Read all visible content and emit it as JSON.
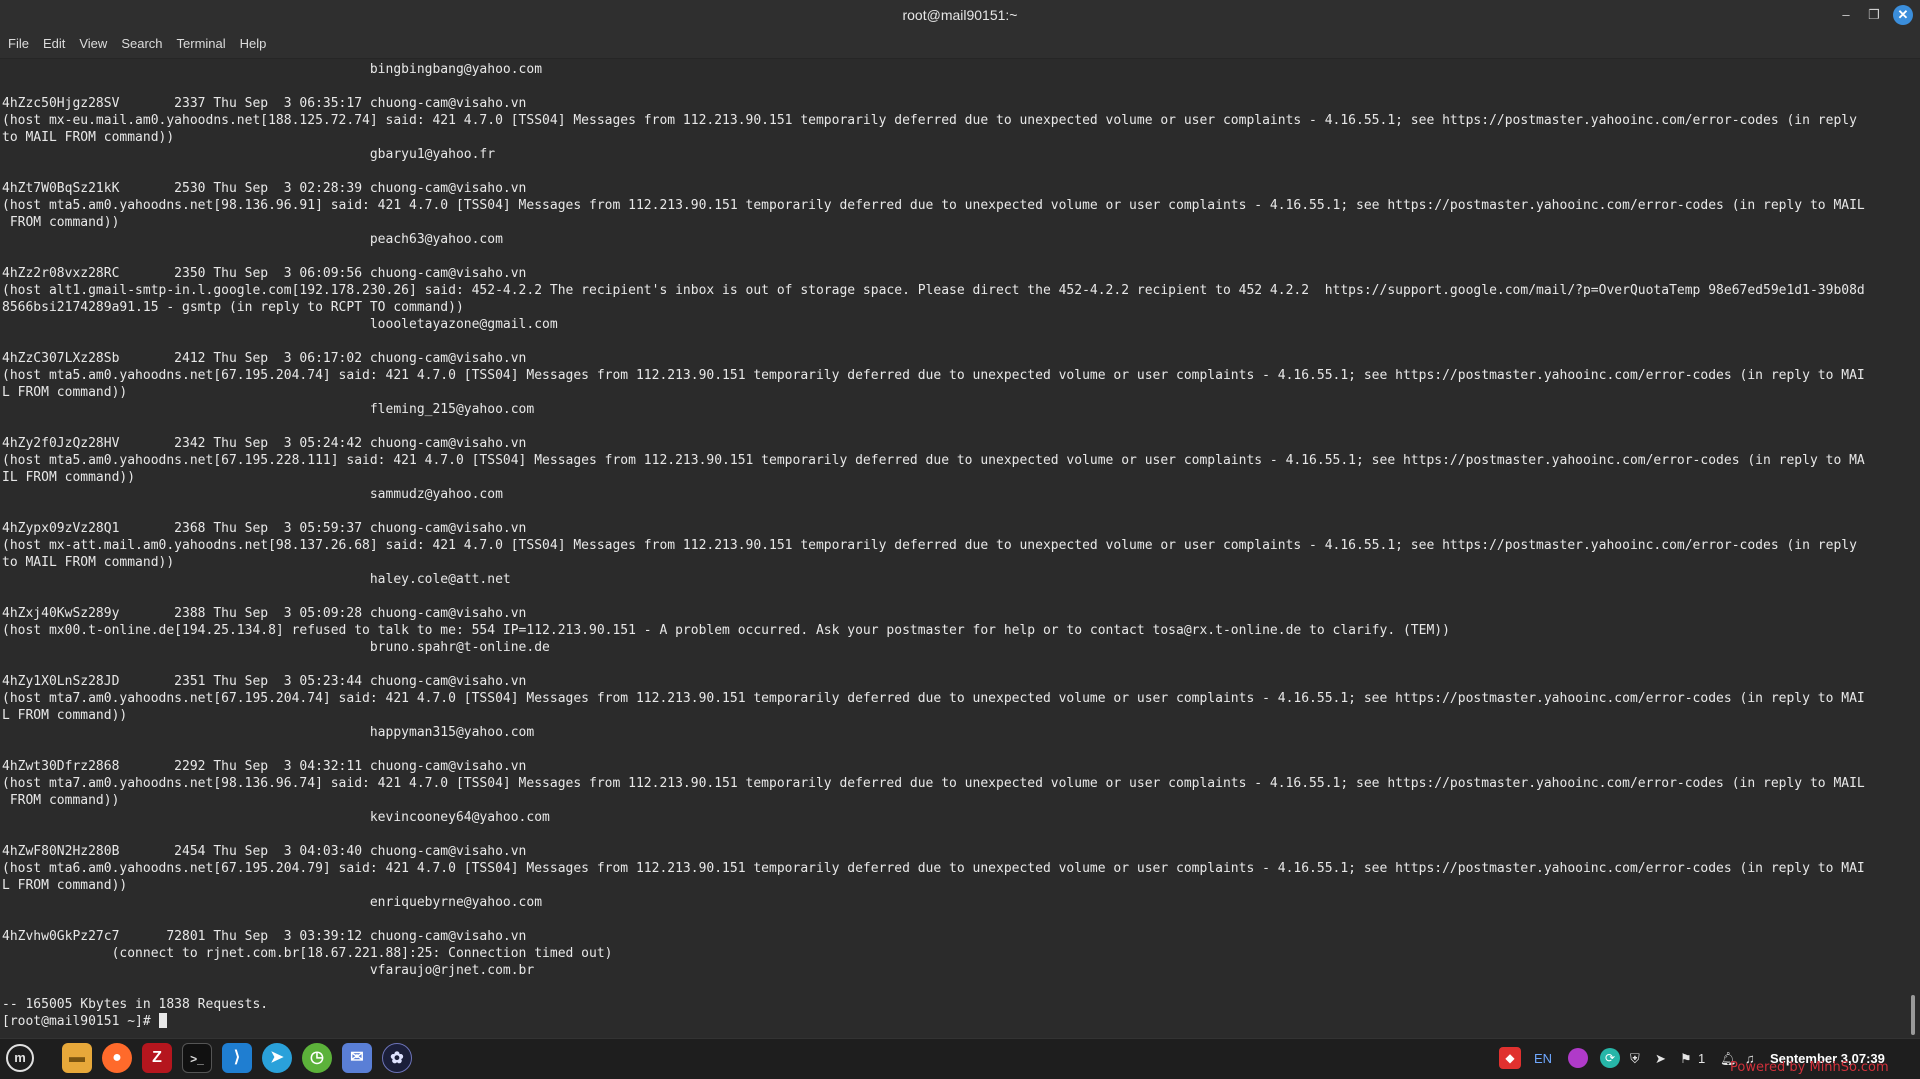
{
  "window": {
    "title": "root@mail90151:~",
    "min_glyph": "–",
    "max_glyph": "❐",
    "close_glyph": "✕"
  },
  "menu": [
    "File",
    "Edit",
    "View",
    "Search",
    "Terminal",
    "Help"
  ],
  "terminal": {
    "lines": [
      "                                               bingbingbang@yahoo.com",
      "",
      "4hZzc50Hjgz28SV       2337 Thu Sep  3 06:35:17 chuong-cam@visaho.vn",
      "(host mx-eu.mail.am0.yahoodns.net[188.125.72.74] said: 421 4.7.0 [TSS04] Messages from 112.213.90.151 temporarily deferred due to unexpected volume or user complaints - 4.16.55.1; see https://postmaster.yahooinc.com/error-codes (in reply",
      "to MAIL FROM command))",
      "                                               gbaryu1@yahoo.fr",
      "",
      "4hZt7W0BqSz21kK       2530 Thu Sep  3 02:28:39 chuong-cam@visaho.vn",
      "(host mta5.am0.yahoodns.net[98.136.96.91] said: 421 4.7.0 [TSS04] Messages from 112.213.90.151 temporarily deferred due to unexpected volume or user complaints - 4.16.55.1; see https://postmaster.yahooinc.com/error-codes (in reply to MAIL",
      " FROM command))",
      "                                               peach63@yahoo.com",
      "",
      "4hZz2r08vxz28RC       2350 Thu Sep  3 06:09:56 chuong-cam@visaho.vn",
      "(host alt1.gmail-smtp-in.l.google.com[192.178.230.26] said: 452-4.2.2 The recipient's inbox is out of storage space. Please direct the 452-4.2.2 recipient to 452 4.2.2  https://support.google.com/mail/?p=OverQuotaTemp 98e67ed59e1d1-39b08d",
      "8566bsi2174289a91.15 - gsmtp (in reply to RCPT TO command))",
      "                                               loooletayazone@gmail.com",
      "",
      "4hZzC307LXz28Sb       2412 Thu Sep  3 06:17:02 chuong-cam@visaho.vn",
      "(host mta5.am0.yahoodns.net[67.195.204.74] said: 421 4.7.0 [TSS04] Messages from 112.213.90.151 temporarily deferred due to unexpected volume or user complaints - 4.16.55.1; see https://postmaster.yahooinc.com/error-codes (in reply to MAI",
      "L FROM command))",
      "                                               fleming_215@yahoo.com",
      "",
      "4hZy2f0JzQz28HV       2342 Thu Sep  3 05:24:42 chuong-cam@visaho.vn",
      "(host mta5.am0.yahoodns.net[67.195.228.111] said: 421 4.7.0 [TSS04] Messages from 112.213.90.151 temporarily deferred due to unexpected volume or user complaints - 4.16.55.1; see https://postmaster.yahooinc.com/error-codes (in reply to MA",
      "IL FROM command))",
      "                                               sammudz@yahoo.com",
      "",
      "4hZypx09zVz28Q1       2368 Thu Sep  3 05:59:37 chuong-cam@visaho.vn",
      "(host mx-att.mail.am0.yahoodns.net[98.137.26.68] said: 421 4.7.0 [TSS04] Messages from 112.213.90.151 temporarily deferred due to unexpected volume or user complaints - 4.16.55.1; see https://postmaster.yahooinc.com/error-codes (in reply",
      "to MAIL FROM command))",
      "                                               haley.cole@att.net",
      "",
      "4hZxj40KwSz289y       2388 Thu Sep  3 05:09:28 chuong-cam@visaho.vn",
      "(host mx00.t-online.de[194.25.134.8] refused to talk to me: 554 IP=112.213.90.151 - A problem occurred. Ask your postmaster for help or to contact tosa@rx.t-online.de to clarify. (TEM))",
      "                                               bruno.spahr@t-online.de",
      "",
      "4hZy1X0LnSz28JD       2351 Thu Sep  3 05:23:44 chuong-cam@visaho.vn",
      "(host mta7.am0.yahoodns.net[67.195.204.74] said: 421 4.7.0 [TSS04] Messages from 112.213.90.151 temporarily deferred due to unexpected volume or user complaints - 4.16.55.1; see https://postmaster.yahooinc.com/error-codes (in reply to MAI",
      "L FROM command))",
      "                                               happyman315@yahoo.com",
      "",
      "4hZwt30Dfrz2868       2292 Thu Sep  3 04:32:11 chuong-cam@visaho.vn",
      "(host mta7.am0.yahoodns.net[98.136.96.74] said: 421 4.7.0 [TSS04] Messages from 112.213.90.151 temporarily deferred due to unexpected volume or user complaints - 4.16.55.1; see https://postmaster.yahooinc.com/error-codes (in reply to MAIL",
      " FROM command))",
      "                                               kevincooney64@yahoo.com",
      "",
      "4hZwF80N2Hz280B       2454 Thu Sep  3 04:03:40 chuong-cam@visaho.vn",
      "(host mta6.am0.yahoodns.net[67.195.204.79] said: 421 4.7.0 [TSS04] Messages from 112.213.90.151 temporarily deferred due to unexpected volume or user complaints - 4.16.55.1; see https://postmaster.yahooinc.com/error-codes (in reply to MAI",
      "L FROM command))",
      "                                               enriquebyrne@yahoo.com",
      "",
      "4hZvhw0GkPz27c7      72801 Thu Sep  3 03:39:12 chuong-cam@visaho.vn",
      "              (connect to rjnet.com.br[18.67.221.88]:25: Connection timed out)",
      "                                               vfaraujo@rjnet.com.br",
      "",
      "-- 165005 Kbytes in 1838 Requests."
    ],
    "prompt": "[root@mail90151 ~]# "
  },
  "taskbar": {
    "apps": [
      "mint-menu-icon",
      "files-icon",
      "firefox-icon",
      "filezilla-icon",
      "terminal-icon",
      "vscode-icon",
      "telegram-icon",
      "greenshot-icon",
      "mail-icon",
      "chatgpt-icon"
    ],
    "tray": {
      "keyboard_layout": "EN",
      "notifications_count": "1"
    },
    "clock": "September  3,07:39"
  },
  "watermark": "Powered by MinhSo.com",
  "colors": {
    "terminal_bg": "#2b2b2b",
    "terminal_fg": "#e8e8e8",
    "titlebar_bg": "#2f2f2f",
    "taskbar_bg": "#1e1e1e",
    "close_accent": "#3b8edb"
  }
}
